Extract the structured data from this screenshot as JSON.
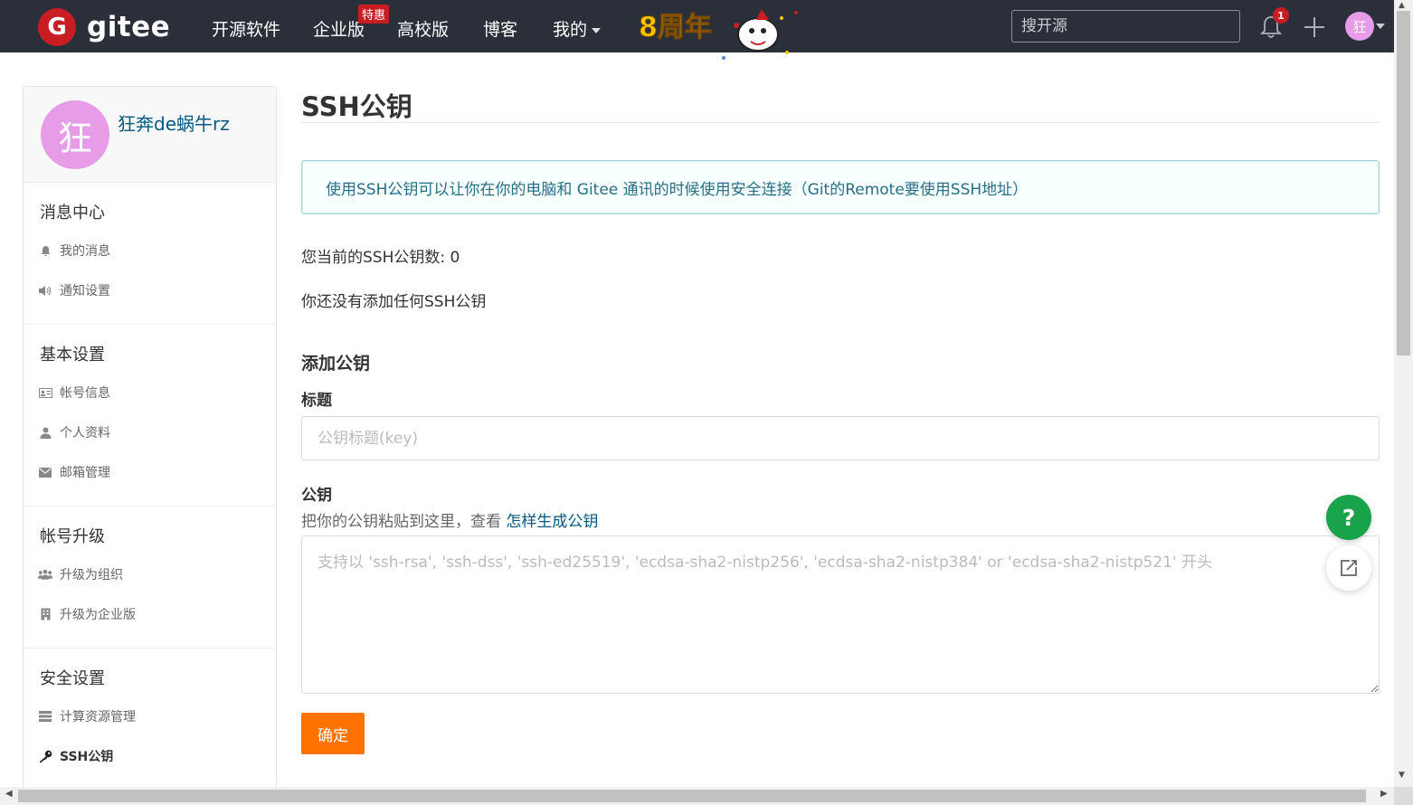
{
  "topbar": {
    "logo_mark": "G",
    "logo_text": "gitee",
    "nav": [
      "开源软件",
      "企业版",
      "高校版",
      "博客",
      "我的"
    ],
    "enterprise_badge": "特惠",
    "anniversary_text": "8周年",
    "search_placeholder": "搜开源",
    "notification_count": "1",
    "avatar_initial": "狂"
  },
  "sidebar": {
    "profile": {
      "avatar_initial": "狂",
      "name": "狂奔de蜗牛rz"
    },
    "sections": [
      {
        "title": "消息中心",
        "items": [
          "我的消息",
          "通知设置"
        ]
      },
      {
        "title": "基本设置",
        "items": [
          "帐号信息",
          "个人资料",
          "邮箱管理"
        ]
      },
      {
        "title": "帐号升级",
        "items": [
          "升级为组织",
          "升级为企业版"
        ]
      },
      {
        "title": "安全设置",
        "items": [
          "计算资源管理",
          "SSH公钥"
        ]
      }
    ]
  },
  "main": {
    "title": "SSH公钥",
    "info": "使用SSH公钥可以让你在你的电脑和 Gitee 通讯的时候使用安全连接（Git的Remote要使用SSH地址）",
    "key_count": "您当前的SSH公钥数: 0",
    "no_key": "你还没有添加任何SSH公钥",
    "add_title": "添加公钥",
    "title_label": "标题",
    "title_placeholder": "公钥标题(key)",
    "key_label": "公钥",
    "key_hint": "把你的公钥粘贴到这里，查看 ",
    "key_hint_link": "怎样生成公钥",
    "key_placeholder": "支持以 'ssh-rsa', 'ssh-dss', 'ssh-ed25519', 'ecdsa-sha2-nistp256', 'ecdsa-sha2-nistp384' or 'ecdsa-sha2-nistp521' 开头",
    "submit": "确定"
  },
  "floating": {
    "help": "?"
  },
  "colors": {
    "topbar": "#2b2f3a",
    "brand_red": "#c71d23",
    "accent_orange": "#fe7300",
    "link": "#005980",
    "help_green": "#19a34b",
    "avatar": "#e79ce8"
  }
}
